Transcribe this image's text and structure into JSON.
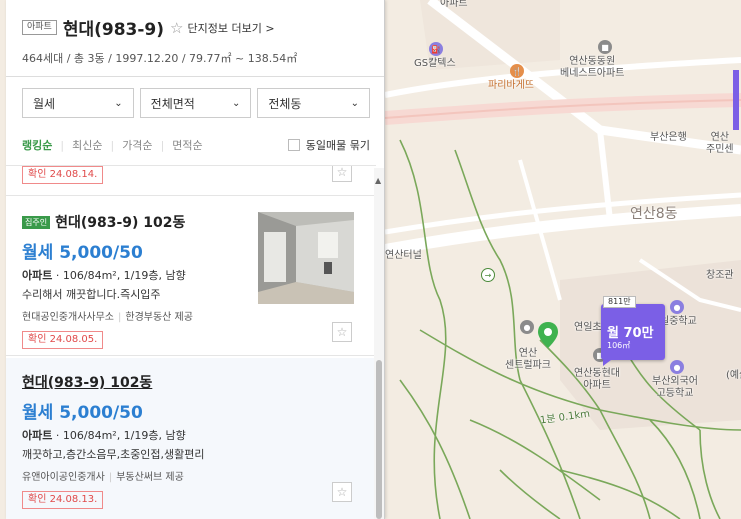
{
  "complex": {
    "type_badge": "아파트",
    "name": "현대(983-9)",
    "star": "☆",
    "more_link": "단지정보 더보기 >",
    "info": "464세대 / 총 3동 / 1997.12.20 / 79.77㎡ ~ 138.54㎡"
  },
  "filters": {
    "deal_type": "월세",
    "area": "전체면적",
    "dong": "전체동"
  },
  "sort": {
    "ranking": "랭킹순",
    "latest": "최신순",
    "price": "가격순",
    "area": "면적순",
    "group_label": "동일매물 묶기"
  },
  "listings": [
    {
      "confirm": "확인 24.08.14."
    },
    {
      "owner_badge": "집주인",
      "title": "현대(983-9) 102동",
      "price": "월세 5,000/50",
      "spec_type": "아파트",
      "spec_rest": " · 106/84m², 1/19층, 남향",
      "desc": "수리해서 깨끗합니다.즉시입주",
      "agent": "현대공인중개사사무소",
      "source": "한경부동산 제공",
      "confirm": "확인 24.08.05."
    },
    {
      "title": "현대(983-9) 102동",
      "price": "월세 5,000/50",
      "spec_type": "아파트",
      "spec_rest": " · 106/84m², 1/19층, 남향",
      "desc": "깨끗하고,층간소음무,초중인접,생활편리",
      "agent": "유앤아이공인중개사",
      "source": "부동산써브 제공",
      "confirm": "확인 24.08.13."
    }
  ],
  "map": {
    "labels": {
      "apt_top": "아파트",
      "gs": "GS칼텍스",
      "hospital": "연산동동원\n베네스트아파트",
      "paris": "파리바게뜨",
      "busan_bank": "부산은행",
      "yeonsan_center": "연산\n주민센",
      "dong8": "연산8동",
      "tunnel": "연산터널",
      "jochon": "창조관",
      "yeonil": "연일초",
      "ilchung": "일중학교",
      "centro": "연산\n센트럴파크",
      "hyundai_apt": "연산동현대\n아파트",
      "foreign_school": "부산외국어\n고등학교",
      "ye": "(예술",
      "walk": "1분 0.1km"
    },
    "marker": {
      "tag": "811만",
      "price": "월 70만",
      "area": "106㎡"
    }
  }
}
